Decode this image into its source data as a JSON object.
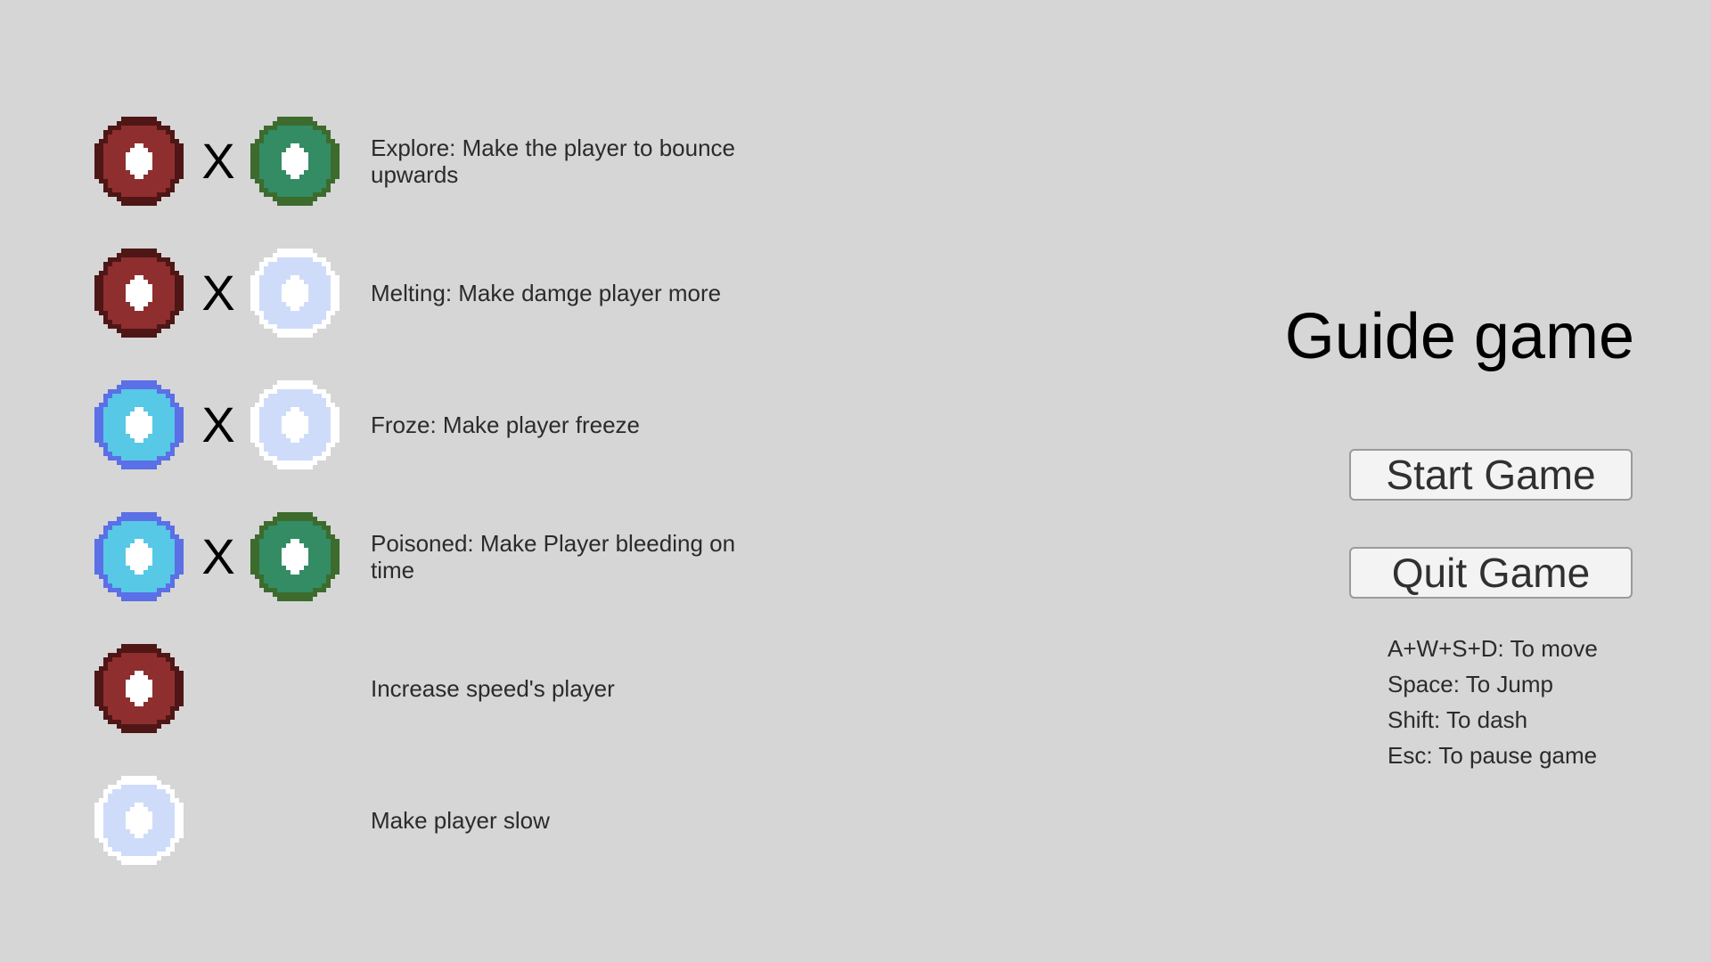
{
  "palette": {
    "background": "#d6d6d6",
    "fire_orb": {
      "dark": "#4f1616",
      "main": "#8f2e2e",
      "core": "#ffffff"
    },
    "poison_orb": {
      "dark": "#3d6b2d",
      "main": "#338c63",
      "core": "#ffffff"
    },
    "ice_orb": {
      "dark": "#5b6fe6",
      "main": "#57c8e6",
      "core": "#ffffff"
    },
    "snow_orb": {
      "dark": "#ffffff",
      "main": "#cfdcf9",
      "core": "#ffffff"
    }
  },
  "combos": [
    {
      "orb_a": "fire-orb",
      "operator": "X",
      "orb_b": "poison-orb",
      "description": "Explore: Make the player to bounce upwards"
    },
    {
      "orb_a": "fire-orb",
      "operator": "X",
      "orb_b": "snow-orb",
      "description": "Melting: Make damge player more"
    },
    {
      "orb_a": "ice-orb",
      "operator": "X",
      "orb_b": "snow-orb",
      "description": "Froze: Make player freeze"
    },
    {
      "orb_a": "ice-orb",
      "operator": "X",
      "orb_b": "poison-orb",
      "description": "Poisoned: Make Player bleeding on time"
    },
    {
      "orb_a": "fire-orb",
      "description": "Increase speed's player"
    },
    {
      "orb_a": "snow-orb",
      "description": "Make player slow"
    }
  ],
  "menu": {
    "title": "Guide game",
    "start_label": "Start Game",
    "quit_label": "Quit Game"
  },
  "controls": [
    "A+W+S+D: To move",
    "Space: To Jump",
    "Shift: To dash",
    "Esc: To pause game"
  ]
}
